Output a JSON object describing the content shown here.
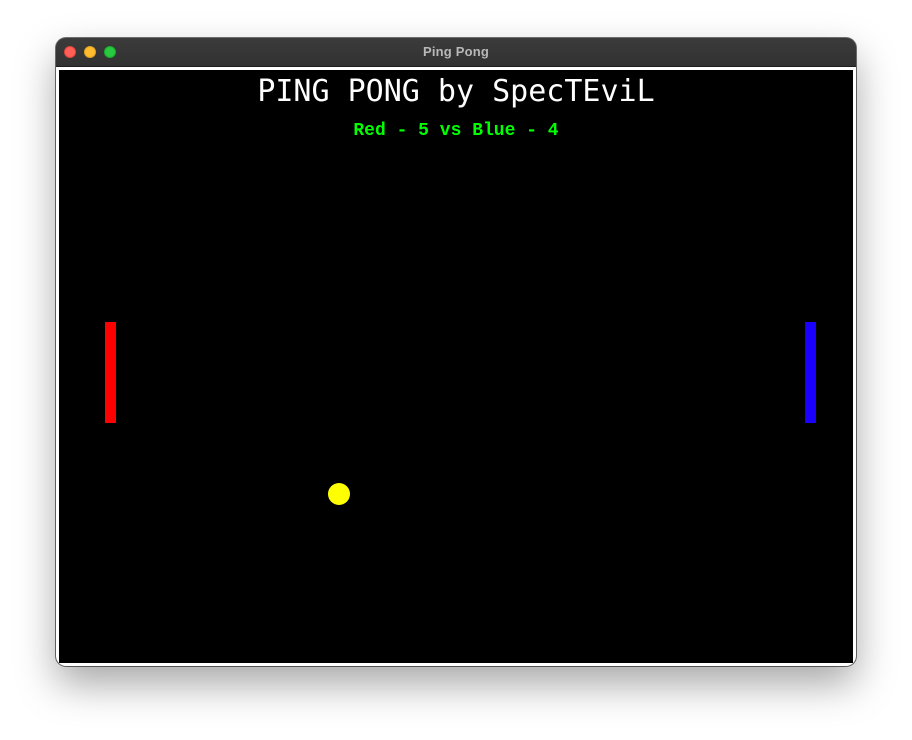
{
  "window": {
    "title": "Ping Pong",
    "controls": {
      "close_icon": "close-traffic-light",
      "minimize_icon": "minimize-traffic-light",
      "zoom_icon": "zoom-traffic-light"
    }
  },
  "game": {
    "title": "PING PONG by SpecTEviL",
    "score_text": "Red - 5 vs Blue - 4",
    "score": {
      "red": 5,
      "blue": 4
    },
    "colors": {
      "background": "#000000",
      "title": "#ffffff",
      "score": "#00ff00",
      "red_paddle": "#ff0000",
      "blue_paddle": "#1a00ff",
      "ball": "#ffff00"
    }
  }
}
